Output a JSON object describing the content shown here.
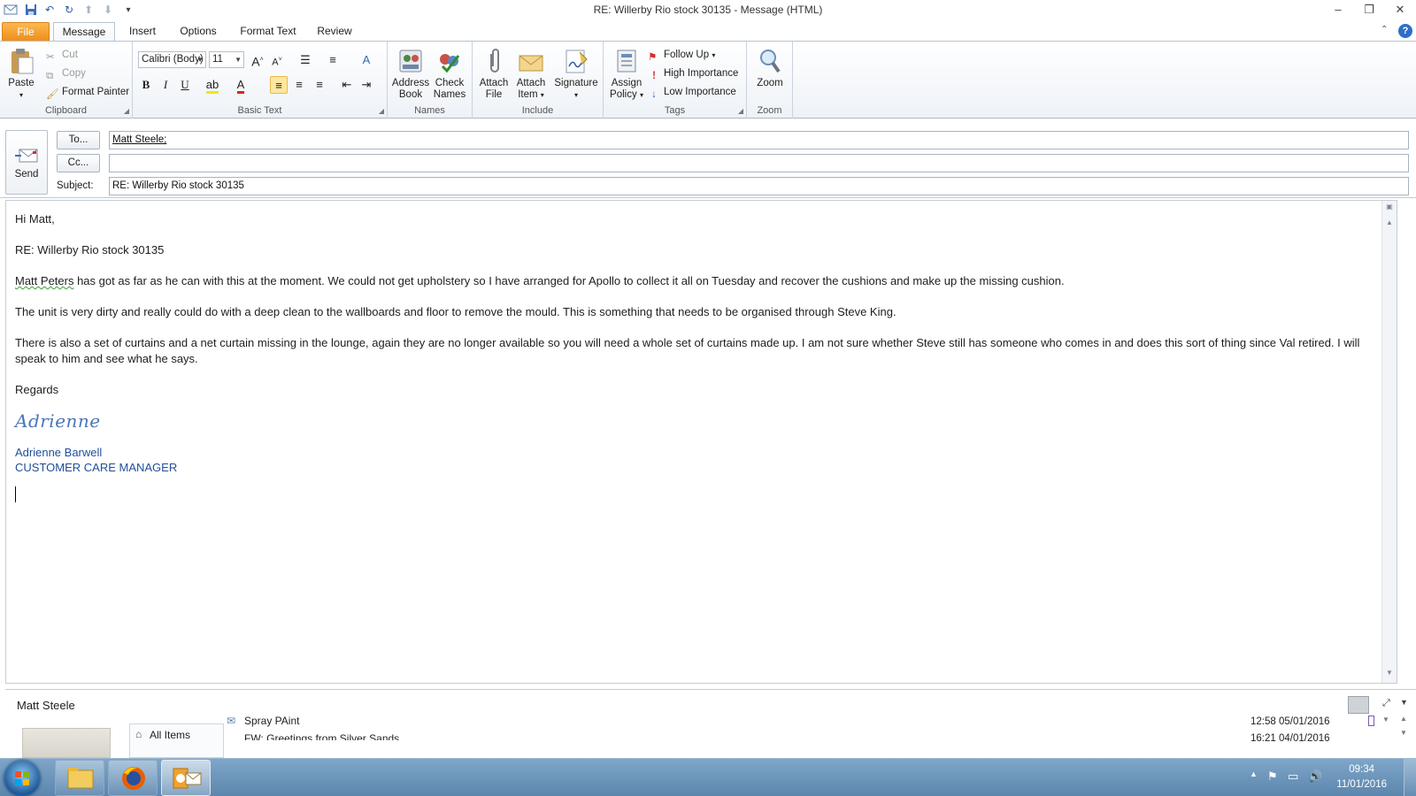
{
  "window": {
    "title": "RE: Willerby Rio stock 30135  -  Message (HTML)"
  },
  "tabs": [
    "File",
    "Message",
    "Insert",
    "Options",
    "Format Text",
    "Review"
  ],
  "ribbon": {
    "clipboard": {
      "label": "Clipboard",
      "paste": "Paste",
      "cut": "Cut",
      "copy": "Copy",
      "format_painter": "Format Painter"
    },
    "basic_text": {
      "label": "Basic Text",
      "font": "Calibri (Body)",
      "size": "11",
      "bold": "B",
      "italic": "I",
      "underline": "U"
    },
    "names": {
      "label": "Names",
      "address_book": [
        "Address",
        "Book"
      ],
      "check_names": [
        "Check",
        "Names"
      ]
    },
    "include": {
      "label": "Include",
      "attach_file": [
        "Attach",
        "File"
      ],
      "attach_item": [
        "Attach",
        "Item"
      ],
      "signature": "Signature"
    },
    "tags": {
      "label": "Tags",
      "assign_policy": [
        "Assign",
        "Policy"
      ],
      "follow_up": "Follow Up",
      "high_importance": "High Importance",
      "low_importance": "Low Importance"
    },
    "zoom": {
      "label": "Zoom",
      "zoom": "Zoom"
    }
  },
  "compose": {
    "send": "Send",
    "to_button": "To...",
    "cc_button": "Cc...",
    "subject_label": "Subject:",
    "to_value": "Matt Steele;",
    "cc_value": "",
    "subject_value": "RE: Willerby Rio stock 30135"
  },
  "body": {
    "greeting": "Hi Matt,",
    "ref": "RE: Willerby Rio stock 30135",
    "para1_name": "Matt Peters",
    "para1_rest": "  has got as far as he can with this at the moment.  We could not get upholstery so I have arranged for Apollo to collect it all on Tuesday and recover the cushions and make up the missing cushion.",
    "para2": "The unit is very dirty and really could do with a deep clean to the wallboards and floor to remove the mould.  This is something that needs to be organised through Steve King.",
    "para3": "There is also a set of curtains and a net curtain missing in the lounge, again they are no longer available so you will need a whole set of curtains made up.  I am not sure whether Steve still has someone who comes in and does this sort of thing since Val retired.  I will speak to him and see what he says.",
    "regards": "Regards",
    "signature_script": "Adrienne",
    "sig_name": "Adrienne Barwell",
    "sig_title": "CUSTOMER CARE MANAGER"
  },
  "people_pane": {
    "name": "Matt Steele",
    "nav_all_items": "All Items",
    "items": [
      {
        "subject": "Spray PAint",
        "date": "12:58  05/01/2016"
      },
      {
        "subject": "FW: Greetings from Silver Sands",
        "date": "16:21  04/01/2016"
      }
    ]
  },
  "taskbar": {
    "time": "09:34",
    "date": "11/01/2016"
  },
  "colors": {
    "file_tab": "#ee8e1a",
    "signature_blue": "#1f4e9a",
    "taskbar": "#6b91b8"
  }
}
